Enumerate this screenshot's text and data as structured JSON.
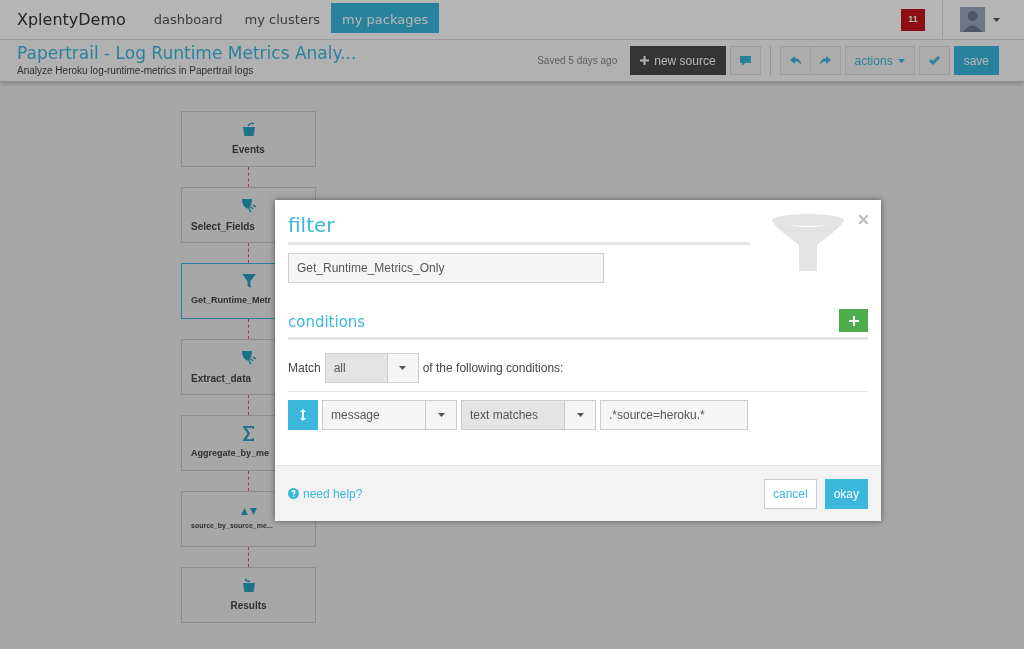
{
  "navbar": {
    "brand": "XplentyDemo",
    "links": [
      {
        "label": "dashboard",
        "selected": false
      },
      {
        "label": "my clusters",
        "selected": false
      },
      {
        "label": "my packages",
        "selected": true
      }
    ],
    "notification_count": "11"
  },
  "package": {
    "title": "Papertrail - Log Runtime Metrics Analy...",
    "description": "Analyze Heroku log-runtime-metrics in Papertrail logs",
    "saved_status": "Saved 5 days ago"
  },
  "toolbar": {
    "new_source": "new source",
    "actions": "actions",
    "save": "save"
  },
  "pipeline": [
    {
      "label": "Events",
      "kind": "source",
      "selected": false
    },
    {
      "label": "Select_Fields",
      "kind": "select",
      "selected": false
    },
    {
      "label": "Get_Runtime_Metr",
      "kind": "filter",
      "selected": true
    },
    {
      "label": "Extract_data",
      "kind": "select",
      "selected": false
    },
    {
      "label": "Aggregate_by_me",
      "kind": "aggregate",
      "selected": false
    },
    {
      "label": "source_by_source_me...",
      "kind": "sort",
      "selected": false
    },
    {
      "label": "Results",
      "kind": "destination",
      "selected": false
    }
  ],
  "dialog": {
    "title": "filter",
    "name": {
      "value": "Get_Runtime_Metrics_Only"
    },
    "conditions_heading": "conditions",
    "match_label": "Match",
    "match_value": "all",
    "match_suffix": "of the following conditions:",
    "conditions": [
      {
        "field": "message",
        "operator": "text matches",
        "value": ".*source=heroku.*"
      }
    ],
    "help_link": "need help?",
    "cancel": "cancel",
    "okay": "okay"
  }
}
